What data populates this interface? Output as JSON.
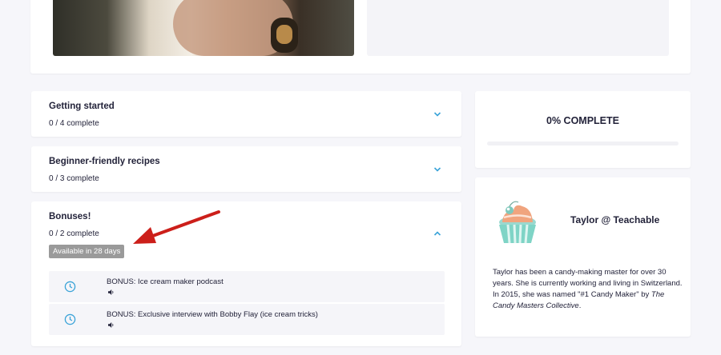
{
  "sections": [
    {
      "title": "Getting started",
      "count": "0 / 4 complete"
    },
    {
      "title": "Beginner-friendly recipes",
      "count": "0 / 3 complete"
    },
    {
      "title": "Bonuses!",
      "count": "0 / 2 complete",
      "badge": "Available in 28 days",
      "lessons": [
        {
          "title": "BONUS: Ice cream maker podcast",
          "icon": "clock-icon",
          "media_icon": "speaker-icon"
        },
        {
          "title": "BONUS: Exclusive interview with Bobby Flay (ice cream tricks)",
          "icon": "clock-icon",
          "media_icon": "speaker-icon"
        }
      ]
    }
  ],
  "progress": {
    "label": "0% COMPLETE",
    "value": 0
  },
  "author": {
    "name": "Taylor @ Teachable",
    "bio_1": "Taylor has been a candy-making master for over 30 years. She is currently working and living in Switzerland. In 2015, she was named \"#1 Candy Maker\" by ",
    "bio_em": "The Candy Masters Collective",
    "bio_2": "."
  },
  "colors": {
    "accent": "#3aa3d8",
    "arrow": "#cc1f1a",
    "badge": "#9a9a9a"
  }
}
